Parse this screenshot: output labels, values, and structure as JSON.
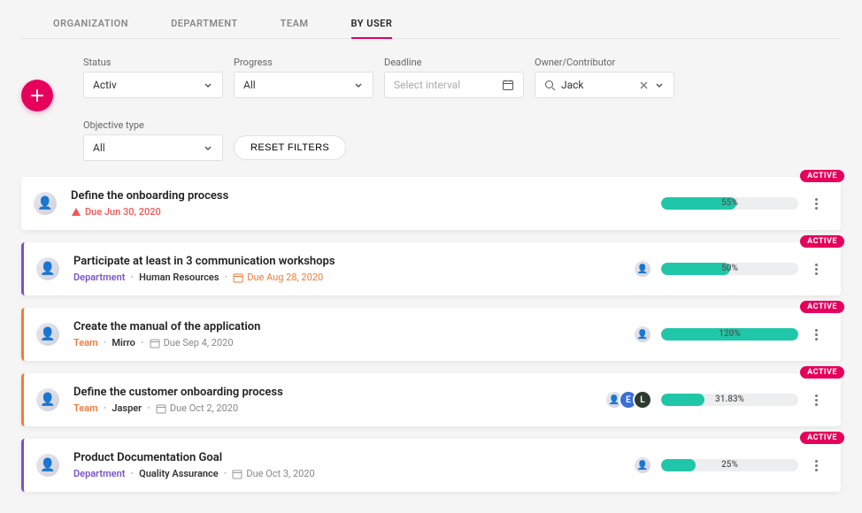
{
  "tabs": {
    "items": [
      "ORGANIZATION",
      "DEPARTMENT",
      "TEAM",
      "BY USER"
    ],
    "active_index": 3
  },
  "filters": {
    "status": {
      "label": "Status",
      "value": "Activ"
    },
    "progress": {
      "label": "Progress",
      "value": "All"
    },
    "deadline": {
      "label": "Deadline",
      "placeholder": "Select interval"
    },
    "owner": {
      "label": "Owner/Contributor",
      "value": "Jack"
    },
    "objective": {
      "label": "Objective type",
      "value": "All"
    },
    "reset_label": "RESET FILTERS"
  },
  "badges": {
    "active": "ACTIVE"
  },
  "objectives": [
    {
      "title": "Define the onboarding process",
      "left_accent": "",
      "scope": null,
      "scope_name": null,
      "due_label": "Due Jun 30, 2020",
      "due_style": "warn",
      "progress_pct": 55,
      "progress_label": "55%",
      "extra_avatars": []
    },
    {
      "title": "Participate at least in 3 communication workshops",
      "left_accent": "purple",
      "scope": "Department",
      "scope_name": "Human Resources",
      "due_label": "Due Aug 28, 2020",
      "due_style": "orange",
      "progress_pct": 50,
      "progress_label": "50%",
      "extra_avatars": [
        {
          "type": "img"
        }
      ]
    },
    {
      "title": "Create the manual of the application",
      "left_accent": "orange",
      "scope": "Team",
      "scope_name": "Mirro",
      "due_label": "Due Sep 4, 2020",
      "due_style": "calendar",
      "progress_pct": 100,
      "progress_label": "120%",
      "extra_avatars": [
        {
          "type": "img"
        }
      ]
    },
    {
      "title": "Define the customer onboarding process",
      "left_accent": "orange",
      "scope": "Team",
      "scope_name": "Jasper",
      "due_label": "Due Oct 2, 2020",
      "due_style": "calendar",
      "progress_pct": 31.83,
      "progress_label": "31.83%",
      "extra_avatars": [
        {
          "type": "img"
        },
        {
          "type": "letter",
          "letter": "E",
          "bg": "#3b6fd6"
        },
        {
          "type": "letter",
          "letter": "L",
          "bg": "#2d3b2e"
        }
      ]
    },
    {
      "title": "Product Documentation Goal",
      "left_accent": "purple",
      "scope": "Department",
      "scope_name": "Quality Assurance",
      "due_label": "Due Oct 3, 2020",
      "due_style": "calendar",
      "progress_pct": 25,
      "progress_label": "25%",
      "extra_avatars": [
        {
          "type": "img"
        }
      ]
    }
  ]
}
